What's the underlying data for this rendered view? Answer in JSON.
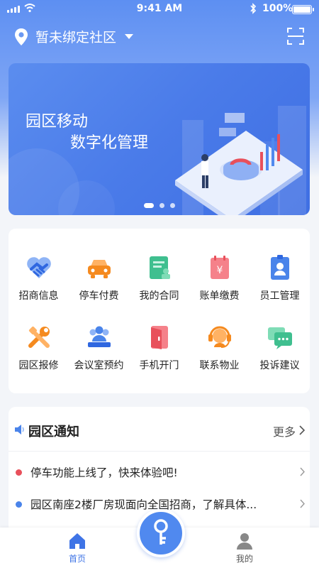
{
  "status_bar": {
    "time": "9:41 AM",
    "battery_text": "100%",
    "battery_level": 1.0
  },
  "header": {
    "location_text": "暂未绑定社区",
    "icons": [
      "location-pin-icon",
      "caret-down-icon",
      "scan-icon"
    ]
  },
  "banner": {
    "line1": "园区移动",
    "line2": "数字化管理",
    "slide_count": 3,
    "active_slide": 1
  },
  "services": [
    {
      "label": "招商信息",
      "icon": "handshake-icon"
    },
    {
      "label": "停车付费",
      "icon": "car-icon"
    },
    {
      "label": "我的合同",
      "icon": "contract-icon"
    },
    {
      "label": "账单缴费",
      "icon": "bill-icon"
    },
    {
      "label": "员工管理",
      "icon": "employee-badge-icon"
    },
    {
      "label": "园区报修",
      "icon": "wrench-icon"
    },
    {
      "label": "会议室预约",
      "icon": "meeting-room-icon"
    },
    {
      "label": "手机开门",
      "icon": "door-icon"
    },
    {
      "label": "联系物业",
      "icon": "headset-icon"
    },
    {
      "label": "投诉建议",
      "icon": "chat-icon"
    }
  ],
  "notice": {
    "title": "园区通知",
    "more": "更多",
    "items": [
      {
        "text": "停车功能上线了，快来体验吧!",
        "dot_color": "#e8505b"
      },
      {
        "text": "园区南座2楼厂房现面向全国招商，了解具体...",
        "dot_color": "#4a84ea"
      }
    ]
  },
  "tabbar": {
    "home_label": "首页",
    "mine_label": "我的",
    "center_icon": "key-icon"
  },
  "colors": {
    "primary": "#3f74e6",
    "accent_blue": "#5089ef",
    "alert_red": "#e8505b"
  }
}
